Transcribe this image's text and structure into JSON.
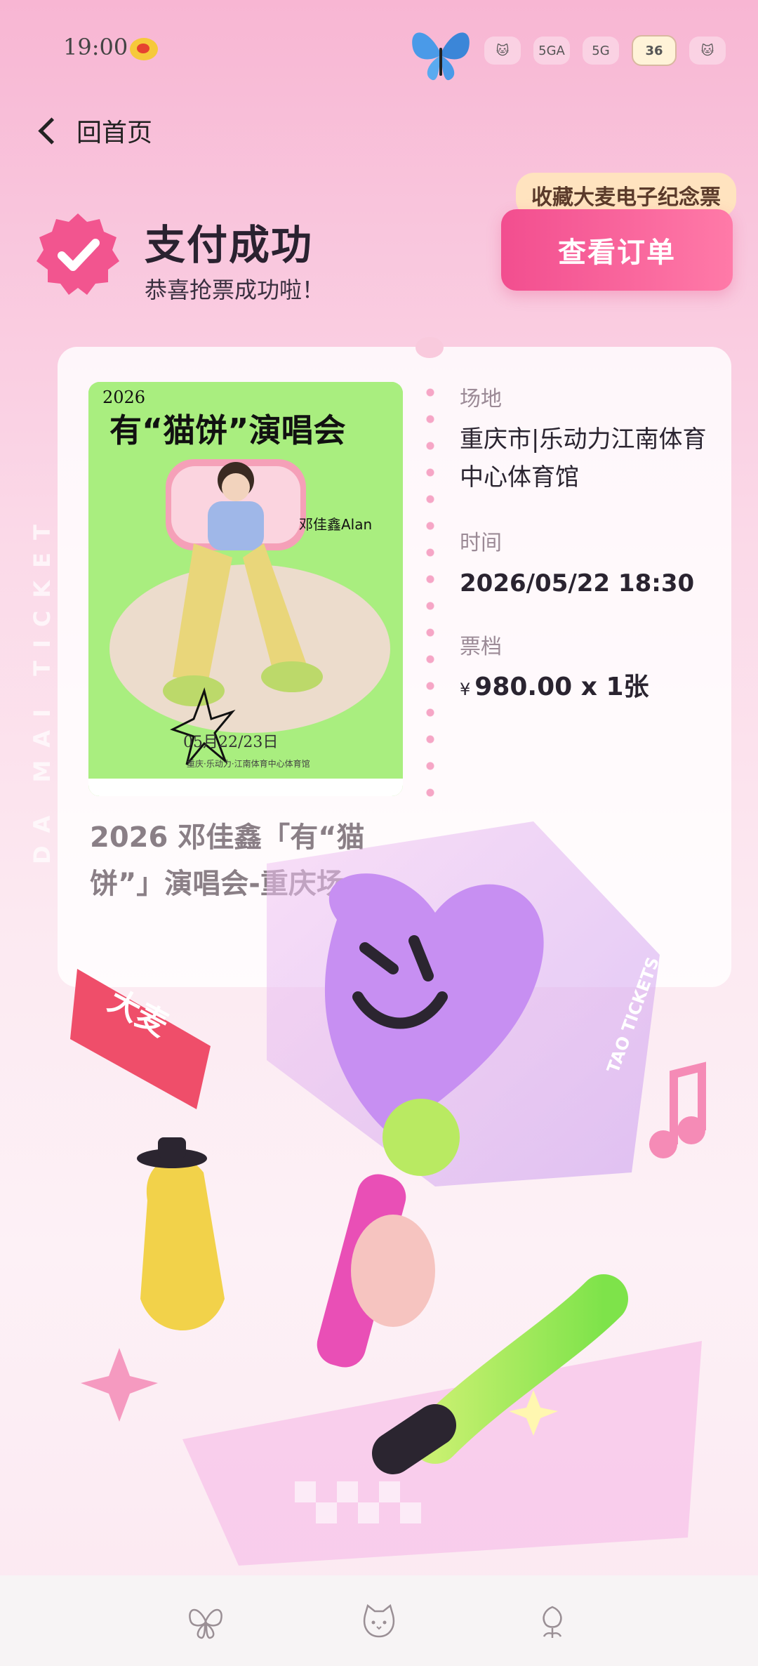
{
  "status_bar": {
    "time": "19:00",
    "battery": "36",
    "network_1": "5GA",
    "network_2": "5G"
  },
  "header": {
    "back_label": "回首页"
  },
  "success": {
    "title": "支付成功",
    "subtitle": "恭喜抢票成功啦！"
  },
  "actions": {
    "tooltip": "收藏大麦电子纪念票",
    "view_order": "查看订单"
  },
  "ticket": {
    "venue_label": "场地",
    "venue_value": "重庆市|乐动力江南体育中心体育馆",
    "time_label": "时间",
    "time_value": "2026/05/22 18:30",
    "tier_label": "票档",
    "tier_currency": "¥",
    "tier_value": "980.00 x 1张",
    "concert_name": "2026 邓佳鑫「有“猫饼”」演唱会-重庆场",
    "side_text": "DA MAI TICKET"
  },
  "poster": {
    "year": "2026",
    "title": "有“猫饼”演唱会",
    "artist": "邓佳鑫Alan",
    "date": "05月22/23日",
    "venue": "重庆·乐动力·江南体育中心体育馆"
  },
  "decoration": {
    "brand": "大麦",
    "badge": "TAO TICKETS"
  },
  "nav": {
    "items": [
      "butterfly-icon",
      "cat-face-icon",
      "flower-icon"
    ]
  },
  "colors": {
    "accent": "#f24e8f",
    "accent_light": "#ff7aa8",
    "tooltip_bg": "#ffe3bf"
  }
}
